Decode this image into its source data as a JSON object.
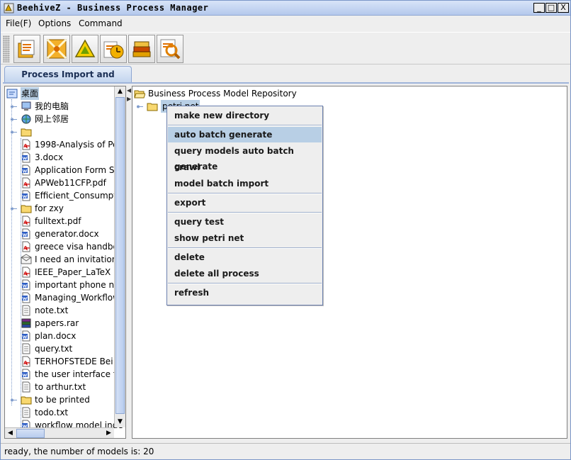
{
  "window": {
    "title": "BeehiveZ - Business Process Manager",
    "buttons": [
      "_",
      "□",
      "X"
    ]
  },
  "menubar": {
    "items": [
      "File(F)",
      "Options",
      "Command"
    ]
  },
  "toolbar": {
    "buttons": [
      "open-doc-icon",
      "layout-icon",
      "triangle-icon",
      "clock-icon",
      "books-icon",
      "search-icon"
    ]
  },
  "tab": {
    "label": "Process Import and Outport"
  },
  "left_tree": {
    "items": [
      {
        "label": "桌面",
        "icon": "desktop-icon"
      },
      {
        "label": "我的电脑",
        "icon": "computer-icon"
      },
      {
        "label": "网上邻居",
        "icon": "network-icon"
      },
      {
        "label": "",
        "icon": "folder-icon"
      },
      {
        "label": "1998-Analysis of Pe",
        "icon": "pdf-icon"
      },
      {
        "label": "3.docx",
        "icon": "doc-icon"
      },
      {
        "label": "Application Form SO",
        "icon": "doc-icon"
      },
      {
        "label": "APWeb11CFP.pdf",
        "icon": "pdf-icon"
      },
      {
        "label": "Efficient_Consumpti",
        "icon": "doc-icon"
      },
      {
        "label": "for zxy",
        "icon": "folder-icon"
      },
      {
        "label": "fulltext.pdf",
        "icon": "pdf-icon"
      },
      {
        "label": "generator.docx",
        "icon": "doc-icon"
      },
      {
        "label": "greece visa handboo",
        "icon": "pdf-icon"
      },
      {
        "label": "I need an invitation le",
        "icon": "mail-icon"
      },
      {
        "label": "IEEE_Paper_LaTeX",
        "icon": "pdf-icon"
      },
      {
        "label": "important phone nur",
        "icon": "doc-icon"
      },
      {
        "label": "Managing_Workflow",
        "icon": "doc-icon"
      },
      {
        "label": "note.txt",
        "icon": "txt-icon"
      },
      {
        "label": "papers.rar",
        "icon": "rar-icon"
      },
      {
        "label": "plan.docx",
        "icon": "doc-icon"
      },
      {
        "label": "query.txt",
        "icon": "txt-icon"
      },
      {
        "label": "TERHOFSTEDE Bei",
        "icon": "pdf-icon"
      },
      {
        "label": "the user interface for",
        "icon": "doc-icon"
      },
      {
        "label": "to arthur.txt",
        "icon": "txt-icon"
      },
      {
        "label": "to be printed",
        "icon": "folder-icon"
      },
      {
        "label": "todo.txt",
        "icon": "txt-icon"
      },
      {
        "label": "workflow model inde",
        "icon": "doc-icon"
      }
    ]
  },
  "right_tree": {
    "root": "Business Process Model Repository",
    "child": "petri net"
  },
  "context_menu": {
    "groups": [
      [
        "make new directory"
      ],
      [
        "auto batch generate",
        "query models auto batch generate",
        "crawl",
        "model batch import"
      ],
      [
        "export"
      ],
      [
        "query test",
        "show petri net"
      ],
      [
        "delete",
        "delete all process"
      ],
      [
        "refresh"
      ]
    ],
    "highlighted": "auto batch generate"
  },
  "status": {
    "text": "ready, the number of models is: 20"
  }
}
